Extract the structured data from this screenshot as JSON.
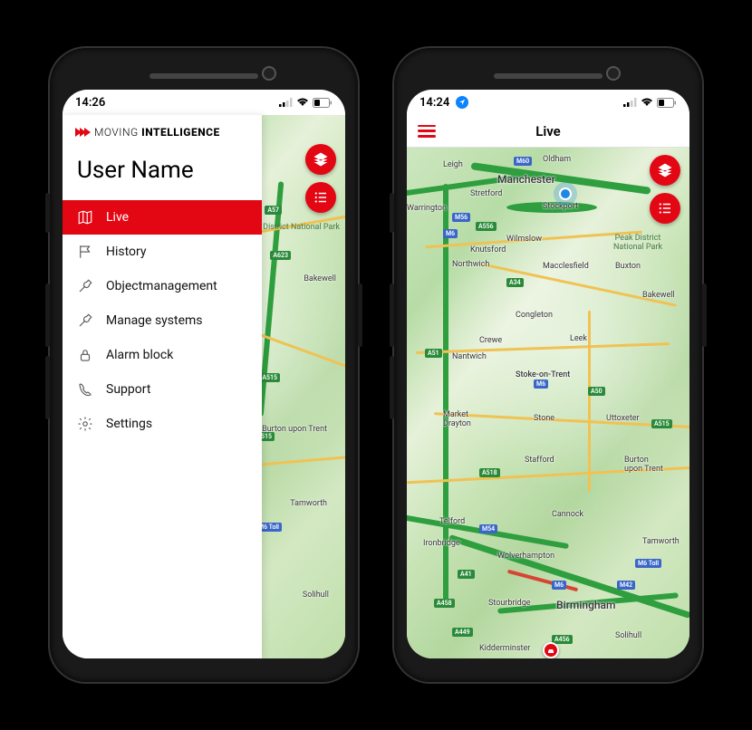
{
  "phone1": {
    "status_time": "14:26",
    "logo_thin": "MOVING ",
    "logo_bold": "INTELLIGENCE",
    "username": "User Name",
    "menu": [
      {
        "label": "Live",
        "icon": "map-icon",
        "active": true
      },
      {
        "label": "History",
        "icon": "flag-icon",
        "active": false
      },
      {
        "label": "Objectmanagement",
        "icon": "wrench-icon",
        "active": false
      },
      {
        "label": "Manage systems",
        "icon": "wrench-icon",
        "active": false
      },
      {
        "label": "Alarm block",
        "icon": "lock-icon",
        "active": false
      },
      {
        "label": "Support",
        "icon": "phone-icon",
        "active": false
      },
      {
        "label": "Settings",
        "icon": "gear-icon",
        "active": false
      }
    ]
  },
  "phone2": {
    "status_time": "14:24",
    "topbar_title": "Live"
  },
  "map_labels": {
    "manchester": "Manchester",
    "birmingham": "Birmingham",
    "stoke": "Stoke-on-Trent",
    "oldham": "Oldham",
    "leigh": "Leigh",
    "stretford": "Stretford",
    "stockport": "Stockport",
    "warrington": "Warrington",
    "wilmslow": "Wilmslow",
    "northwich": "Northwich",
    "macclesfield": "Macclesfield",
    "buxton": "Buxton",
    "bakewell": "Bakewell",
    "knutsford": "Knutsford",
    "congleton": "Congleton",
    "crewe": "Crewe",
    "nantwich": "Nantwich",
    "leek": "Leek",
    "market_drayton": "Market\nDrayton",
    "stone": "Stone",
    "uttoxeter": "Uttoxeter",
    "stafford": "Stafford",
    "burton": "Burton\nupon Trent",
    "telford": "Telford",
    "cannock": "Cannock",
    "ironbridge": "Ironbridge",
    "wolverhampton": "Wolverhampton",
    "tamworth": "Tamworth",
    "stourbridge": "Stourbridge",
    "solihull": "Solihull",
    "kidderminster": "Kidderminster",
    "peak_district": "Peak District\nNational Park",
    "m6": "M6",
    "m60": "M60",
    "m56": "M56",
    "m54": "M54",
    "m42": "M42",
    "m6toll": "M6 Toll",
    "a556": "A556",
    "a34": "A34",
    "a51": "A51",
    "a50": "A50",
    "a515": "A515",
    "a518": "A518",
    "a449": "A449",
    "a458": "A458",
    "a456": "A456",
    "a57": "A57",
    "a623": "A623",
    "a41": "A41"
  }
}
